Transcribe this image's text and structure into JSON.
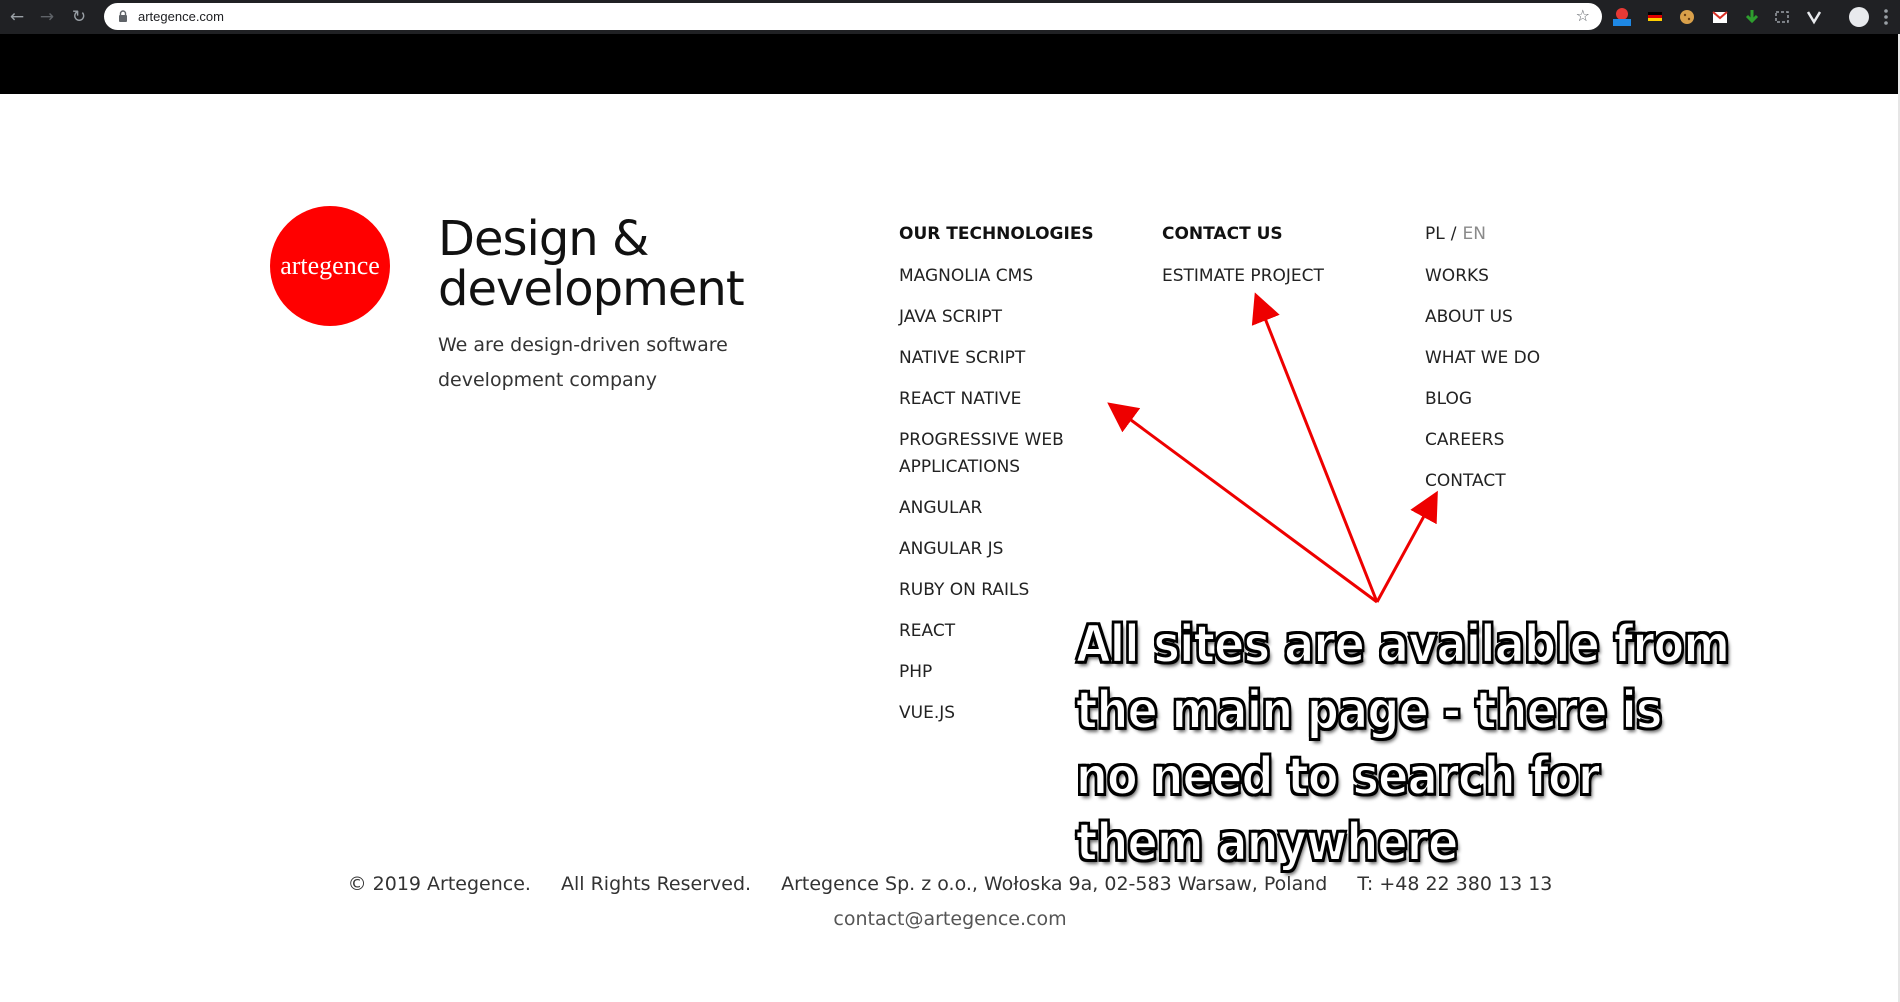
{
  "browser": {
    "url": "artegence.com",
    "nav_back": "←",
    "nav_forward": "→",
    "nav_reload": "↻",
    "star": "☆",
    "extensions": [
      "new-badge-icon",
      "flag-icon",
      "cookie-icon",
      "mail-icon",
      "download-arrow-icon",
      "capture-icon",
      "v-icon"
    ]
  },
  "logo": {
    "text": "artegence",
    "color": "#ff0000"
  },
  "hero": {
    "headline_line1": "Design &",
    "headline_line2": "development",
    "tagline": "We are design-driven software development company"
  },
  "technologies": {
    "heading": "OUR TECHNOLOGIES",
    "items": [
      "MAGNOLIA CMS",
      "JAVA SCRIPT",
      "NATIVE SCRIPT",
      "REACT NATIVE",
      "PROGRESSIVE WEB APPLICATIONS",
      "ANGULAR",
      "ANGULAR JS",
      "RUBY ON RAILS",
      "REACT",
      "PHP",
      "VUE.JS"
    ]
  },
  "contact": {
    "heading": "CONTACT US",
    "items": [
      "ESTIMATE PROJECT"
    ]
  },
  "nav": {
    "lang_pl": "PL",
    "lang_sep": "/",
    "lang_en": "EN",
    "items": [
      "WORKS",
      "ABOUT US",
      "WHAT WE DO",
      "BLOG",
      "CAREERS",
      "CONTACT"
    ]
  },
  "footer": {
    "copyright": "© 2019 Artegence.",
    "rights": "All Rights Reserved.",
    "address": "Artegence Sp. z o.o., Wołoska 9a, 02-583 Warsaw, Poland",
    "phone": "T: +48 22 380 13 13",
    "email": "contact@artegence.com"
  },
  "annotation": {
    "text": "All sites are available from the main page - there is no need to search for them anywhere",
    "arrow_color": "#ee0000"
  }
}
